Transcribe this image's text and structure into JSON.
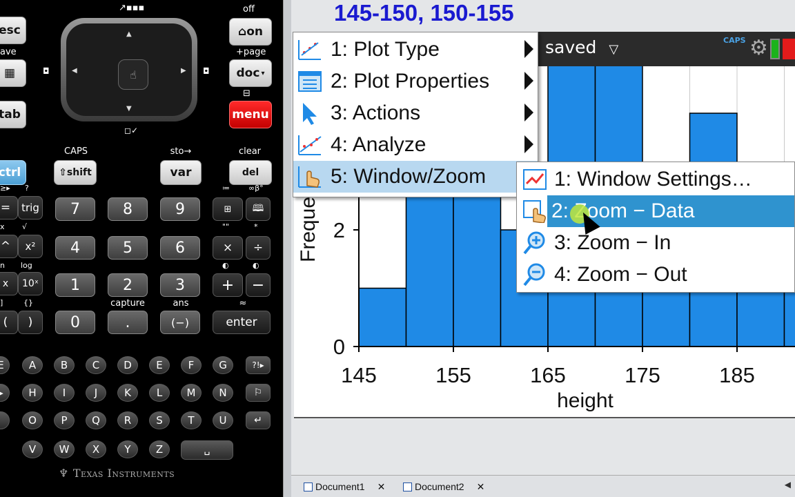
{
  "overlay_text": "145-150, 150-155",
  "titlebar": {
    "doc_title": "saved",
    "caps": "CAPS"
  },
  "keypad": {
    "top_labels": [
      "off",
      "+page",
      "ave"
    ],
    "keys": {
      "esc": "esc",
      "home_on": "on",
      "scratch": "",
      "doc": "doc",
      "tab": "tab",
      "menu": "menu",
      "ctrl": "ctrl",
      "shift": "shift",
      "var": "var",
      "del": "del",
      "trig": "trig",
      "x2": "x²",
      "tenx": "10ˣ",
      "open_paren": "(",
      "close_paren": ")",
      "n7": "7",
      "n8": "8",
      "n9": "9",
      "n4": "4",
      "n5": "5",
      "n6": "6",
      "n1": "1",
      "n2": "2",
      "n3": "3",
      "n0": "0",
      "dot": ".",
      "neg": "(−)",
      "times": "×",
      "divide": "÷",
      "plus": "+",
      "minus": "−",
      "enter": "enter"
    },
    "secondary_labels": {
      "caps": "CAPS",
      "sto": "sto→",
      "clear": "clear",
      "capture": "capture",
      "ans": "ans",
      "approx": "≈",
      "log": "log",
      "sqrt": "√",
      "quote": "\"\"",
      "star": "*"
    },
    "letters_row1": [
      "A",
      "B",
      "C",
      "D",
      "E",
      "F",
      "G"
    ],
    "letters_row2": [
      "H",
      "I",
      "J",
      "K",
      "L",
      "M",
      "N"
    ],
    "letters_row3": [
      "O",
      "P",
      "Q",
      "R",
      "S",
      "T",
      "U"
    ],
    "letters_row4": [
      "V",
      "W",
      "X",
      "Y",
      "Z"
    ],
    "left_edge": [
      "E",
      "",
      ""
    ],
    "extra_keys": {
      "punct": "?!▸",
      "flag": "⚐",
      "return": "↵",
      "space": "␣"
    },
    "brand": "Texas Instruments"
  },
  "chart_data": {
    "type": "bar",
    "title": "",
    "xlabel": "height",
    "ylabel": "Freque",
    "x_ticks": [
      145,
      155,
      165,
      175,
      185
    ],
    "y_ticks": [
      0,
      2
    ],
    "bins": [
      {
        "start": 145,
        "end": 150,
        "value": 1
      },
      {
        "start": 150,
        "end": 155,
        "value": 4
      },
      {
        "start": 155,
        "end": 160,
        "value": 4
      },
      {
        "start": 160,
        "end": 165,
        "value": 2
      },
      {
        "start": 165,
        "end": 170,
        "value": 5
      },
      {
        "start": 170,
        "end": 175,
        "value": 5
      },
      {
        "start": 175,
        "end": 180,
        "value": 1
      },
      {
        "start": 180,
        "end": 185,
        "value": 4
      },
      {
        "start": 185,
        "end": 190,
        "value": 1
      },
      {
        "start": 190,
        "end": 195,
        "value": 1
      }
    ],
    "xlim": [
      145,
      195
    ],
    "ylim": [
      0,
      5.9
    ],
    "bar_color": "#1f8ae6",
    "grid": true
  },
  "menu": {
    "items": [
      {
        "label": "1: Plot Type"
      },
      {
        "label": "2: Plot Properties"
      },
      {
        "label": "3: Actions"
      },
      {
        "label": "4: Analyze"
      },
      {
        "label": "5: Window/Zoom"
      }
    ],
    "submenu": [
      {
        "label": "1: Window Settings…"
      },
      {
        "label": "2: Zoom − Data"
      },
      {
        "label": "3: Zoom − In"
      },
      {
        "label": "4: Zoom − Out"
      }
    ]
  },
  "statusbar": {
    "tabs": [
      "Document1",
      "Document2"
    ]
  }
}
